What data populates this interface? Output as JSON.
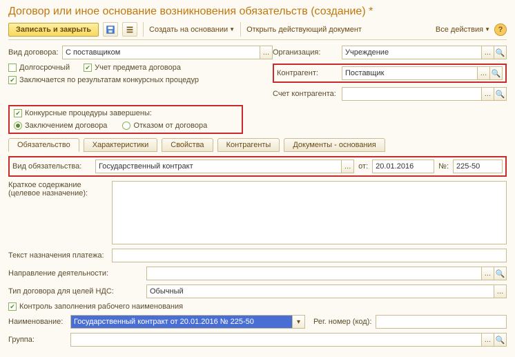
{
  "title": "Договор или иное основание возникновения обязательств (создание) *",
  "toolbar": {
    "save_close": "Записать и закрыть",
    "create_on_basis": "Создать на основании",
    "open_active_doc": "Открыть действующий документ",
    "all_actions": "Все действия"
  },
  "fields": {
    "contract_type_label": "Вид договора:",
    "contract_type_value": "С поставщиком",
    "org_label": "Организация:",
    "org_value": "Учреждение",
    "counterparty_label": "Контрагент:",
    "counterparty_value": "Поставщик",
    "counterparty_account_label": "Счет контрагента:",
    "counterparty_account_value": "",
    "long_term": "Долгосрочный",
    "track_subject": "Учет предмета договора",
    "competitive_closed": "Заключается по результатам конкурсных процедур",
    "competitive_done_label": "Конкурсные процедуры завершены:",
    "by_contract": "Заключением договора",
    "by_refusal": "Отказом от договора"
  },
  "tabs": {
    "t1": "Обязательство",
    "t2": "Характеристики",
    "t3": "Свойства",
    "t4": "Контрагенты",
    "t5": "Документы - основания"
  },
  "obligation": {
    "kind_label": "Вид обязательства:",
    "kind_value": "Государственный контракт",
    "from_label": "от:",
    "date_value": "20.01.2016",
    "num_label": "№:",
    "num_value": "225-50",
    "short_desc_label": "Краткое содержание (целевое назначение):",
    "payment_text_label": "Текст назначения платежа:",
    "activity_dir_label": "Направление деятельности:",
    "vat_type_label": "Тип договора для целей НДС:",
    "vat_type_value": "Обычный",
    "control_label": "Контроль заполнения рабочего наименования",
    "name_label": "Наименование:",
    "name_value": "Государственный контракт от 20.01.2016 № 225-50",
    "reg_num_label": "Рег. номер (код):",
    "reg_num_value": "",
    "group_label": "Группа:",
    "group_value": ""
  }
}
